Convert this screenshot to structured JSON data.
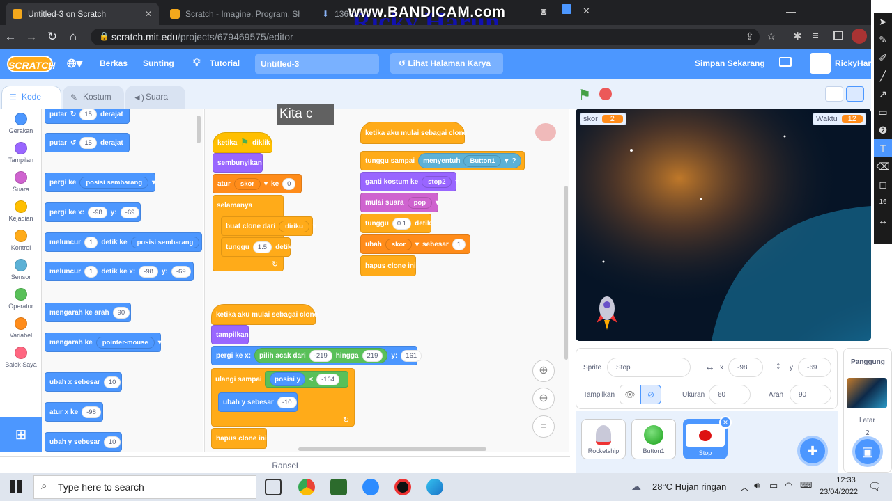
{
  "browser": {
    "tabs": [
      {
        "label": "Untitled-3 on Scratch"
      },
      {
        "label": "Scratch - Imagine, Program, Sh"
      },
      {
        "label": "1366x768"
      }
    ],
    "url_host": "scratch.mit.edu",
    "url_path": "/projects/679469575/editor",
    "watermark": "www.BANDICAM.com",
    "watermark_name": "Ricky Harun"
  },
  "menubar": {
    "logo": "SCRATCH",
    "file": "Berkas",
    "edit": "Sunting",
    "tutorial": "Tutorial",
    "title_value": "Untitled-3",
    "see_project": "Lihat Halaman Karya",
    "save": "Simpan Sekarang",
    "user": "RickyHaru"
  },
  "editor_tabs": {
    "code": "Kode",
    "costume": "Kostum",
    "sound": "Suara"
  },
  "categories": [
    {
      "label": "Gerakan",
      "color": "#4c97ff"
    },
    {
      "label": "Tampilan",
      "color": "#9966ff"
    },
    {
      "label": "Suara",
      "color": "#cf63cf"
    },
    {
      "label": "Kejadian",
      "color": "#ffbf00"
    },
    {
      "label": "Kontrol",
      "color": "#ffab19"
    },
    {
      "label": "Sensor",
      "color": "#5cb1d6"
    },
    {
      "label": "Operator",
      "color": "#59c059"
    },
    {
      "label": "Variabel",
      "color": "#ff8c1a"
    },
    {
      "label": "Balok Saya",
      "color": "#ff6680"
    }
  ],
  "palette": {
    "turn_right": "putar",
    "turn_right_val": "15",
    "degrees": "derajat",
    "turn_left": "putar",
    "turn_left_val": "15",
    "goto": "pergi ke",
    "goto_opt": "posisi sembarang",
    "gotoxy": "pergi ke x:",
    "gotoxy_x": "-98",
    "y_label": "y:",
    "gotoxy_y": "-69",
    "glide": "meluncur",
    "glide_val": "1",
    "glide_sec": "detik ke",
    "glide_opt": "posisi sembarang",
    "glidexy": "meluncur",
    "glidexy_val": "1",
    "glidexy_sec": "detik ke x:",
    "glidexy_x": "-98",
    "glidexy_y": "-69",
    "point": "mengarah ke arah",
    "point_val": "90",
    "pointto": "mengarah ke",
    "pointto_opt": "pointer-mouse",
    "changex": "ubah x sebesar",
    "changex_val": "10",
    "setx": "atur x ke",
    "setx_val": "-98",
    "changey": "ubah y sebesar",
    "changey_val": "10"
  },
  "script1": {
    "hat": "ketika",
    "hat2": "diklik",
    "hide": "sembunyikan",
    "set": "atur",
    "set_var": "skor",
    "set_to": "ke",
    "set_val": "0",
    "forever": "selamanya",
    "clone": "buat clone dari",
    "clone_opt": "diriku",
    "wait": "tunggu",
    "wait_val": "1.5",
    "wait_unit": "detik"
  },
  "script2": {
    "hat": "ketika aku mulai sebagai clone",
    "wait_until": "tunggu sampai",
    "touching": "menyentuh",
    "touch_opt": "Button1",
    "q": "?",
    "costume": "ganti kostum ke",
    "costume_opt": "stop2",
    "sound": "mulai suara",
    "sound_opt": "pop",
    "wait": "tunggu",
    "wait_val": "0.1",
    "wait_unit": "detik",
    "change": "ubah",
    "change_var": "skor",
    "change_by": "sebesar",
    "change_val": "1",
    "delete": "hapus clone ini"
  },
  "script3": {
    "hat": "ketika aku mulai sebagai clone",
    "show": "tampilkan",
    "goto": "pergi ke x:",
    "random": "pilih acak dari",
    "rand_from": "-219",
    "rand_to_lbl": "hingga",
    "rand_to": "219",
    "y_label": "y:",
    "y_val": "161",
    "repeat": "ulangi sampai",
    "ypos": "posisi y",
    "lt": "<",
    "lt_val": "-164",
    "changey": "ubah y sebesar",
    "changey_val": "-10",
    "delete": "hapus clone ini"
  },
  "typing_overlay": "Kita c",
  "backpack": "Ransel",
  "stage": {
    "score_label": "skor",
    "score_val": "2",
    "time_label": "Waktu",
    "time_val": "12"
  },
  "sprite_info": {
    "sprite_label": "Sprite",
    "sprite_name": "Stop",
    "x_label": "x",
    "x_val": "-98",
    "y_label": "y",
    "y_val": "-69",
    "show_label": "Tampilkan",
    "size_label": "Ukuran",
    "size_val": "60",
    "dir_label": "Arah",
    "dir_val": "90"
  },
  "sprites": [
    {
      "name": "Rocketship"
    },
    {
      "name": "Button1"
    },
    {
      "name": "Stop"
    }
  ],
  "stage_panel": {
    "title": "Panggung",
    "backdrops_label": "Latar",
    "backdrops_count": "2"
  },
  "annotation_tools": {
    "size": "16"
  },
  "taskbar": {
    "search": "Type here to search",
    "weather": "28°C  Hujan ringan",
    "time": "12:33",
    "date": "23/04/2022"
  }
}
